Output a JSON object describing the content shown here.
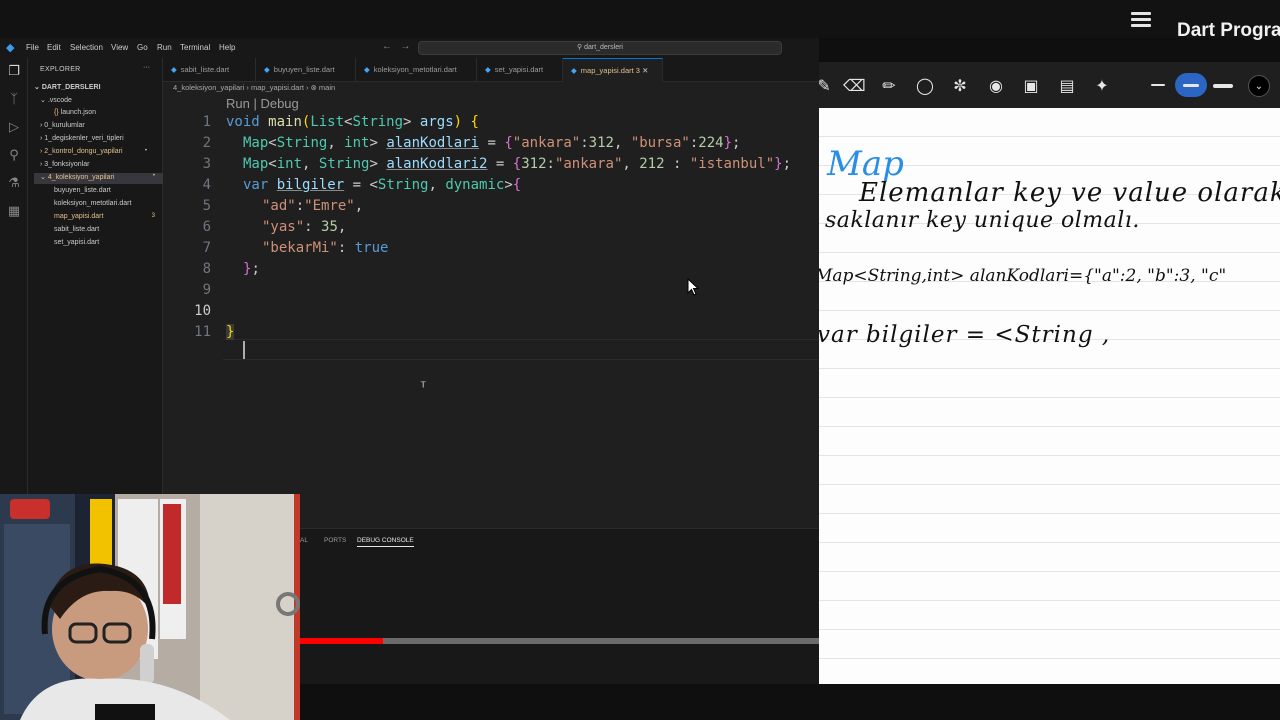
{
  "video": {
    "title": "Dart Progra"
  },
  "vscode": {
    "menu": [
      "File",
      "Edit",
      "Selection",
      "View",
      "Go",
      "Run",
      "Terminal",
      "Help"
    ],
    "search_text": "dart_dersleri",
    "explorer_title": "EXPLORER",
    "tree": [
      {
        "label": "DART_DERSLERI"
      },
      {
        "label": ".vscode"
      },
      {
        "label": "launch.json"
      },
      {
        "label": "0_kurulumlar"
      },
      {
        "label": "1_degiskenler_veri_tipleri"
      },
      {
        "label": "2_kontrol_dongu_yapilari"
      },
      {
        "label": "3_fonksiyonlar"
      },
      {
        "label": "4_koleksiyon_yapilari"
      },
      {
        "label": "buyuyen_liste.dart"
      },
      {
        "label": "koleksiyon_metotlari.dart"
      },
      {
        "label": "map_yapisi.dart"
      },
      {
        "label": "sabit_liste.dart"
      },
      {
        "label": "set_yapisi.dart"
      }
    ],
    "badges": {
      "kontrol": "•",
      "koleksiyon": "•",
      "map": "3"
    },
    "tabs": [
      "sabit_liste.dart",
      "buyuyen_liste.dart",
      "koleksiyon_metotlari.dart",
      "set_yapisi.dart",
      "map_yapisi.dart 3"
    ],
    "breadcrumb": "4_koleksiyon_yapilari  ›  map_yapisi.dart  ›  ⊗ main",
    "codelens": "Run | Debug",
    "line_numbers": [
      "1",
      "2",
      "3",
      "4",
      "5",
      "6",
      "7",
      "8",
      "9",
      "10",
      "11"
    ],
    "code": {
      "l1": [
        "void",
        " ",
        "main",
        "(",
        "List",
        "<",
        "String",
        "> ",
        "args",
        ") ",
        "{"
      ],
      "l2": [
        "Map",
        "<",
        "String",
        ", ",
        "int",
        "> ",
        "alanKodlari",
        " = ",
        "{",
        "\"ankara\"",
        ":",
        "312",
        ", ",
        "\"bursa\"",
        ":",
        "224",
        "}",
        ";"
      ],
      "l3": [
        "Map",
        "<",
        "int",
        ", ",
        "String",
        "> ",
        "alanKodlari2",
        " = ",
        "{",
        "312",
        ":",
        "\"ankara\"",
        ", ",
        "212",
        " : ",
        "\"istanbul\"",
        "}",
        ";"
      ],
      "l4": [
        "var",
        " ",
        "bilgiler",
        " = <",
        "String",
        ", ",
        "dynamic",
        ">",
        "{"
      ],
      "l5": [
        "\"ad\"",
        ":",
        "\"Emre\"",
        ","
      ],
      "l6": [
        "\"yas\"",
        ": ",
        "35",
        ","
      ],
      "l7": [
        "\"bekarMi\"",
        ": ",
        "true"
      ],
      "l8": [
        "}",
        ";"
      ],
      "l11": [
        "}"
      ]
    },
    "panel_tabs": [
      "AL",
      "PORTS",
      "DEBUG CONSOLE"
    ],
    "progress": 0.16
  },
  "whiteboard": {
    "heading": "Map",
    "line1": "Elemanlar key ve value olarak",
    "line2": "saklanır key unique olmalı.",
    "line3": "Map<String,int> alanKodlari={\"a\":2, \"b\":3, \"c\"",
    "line4": "var bilgiler = <String ,",
    "heading_color": "#2a8ee6"
  }
}
